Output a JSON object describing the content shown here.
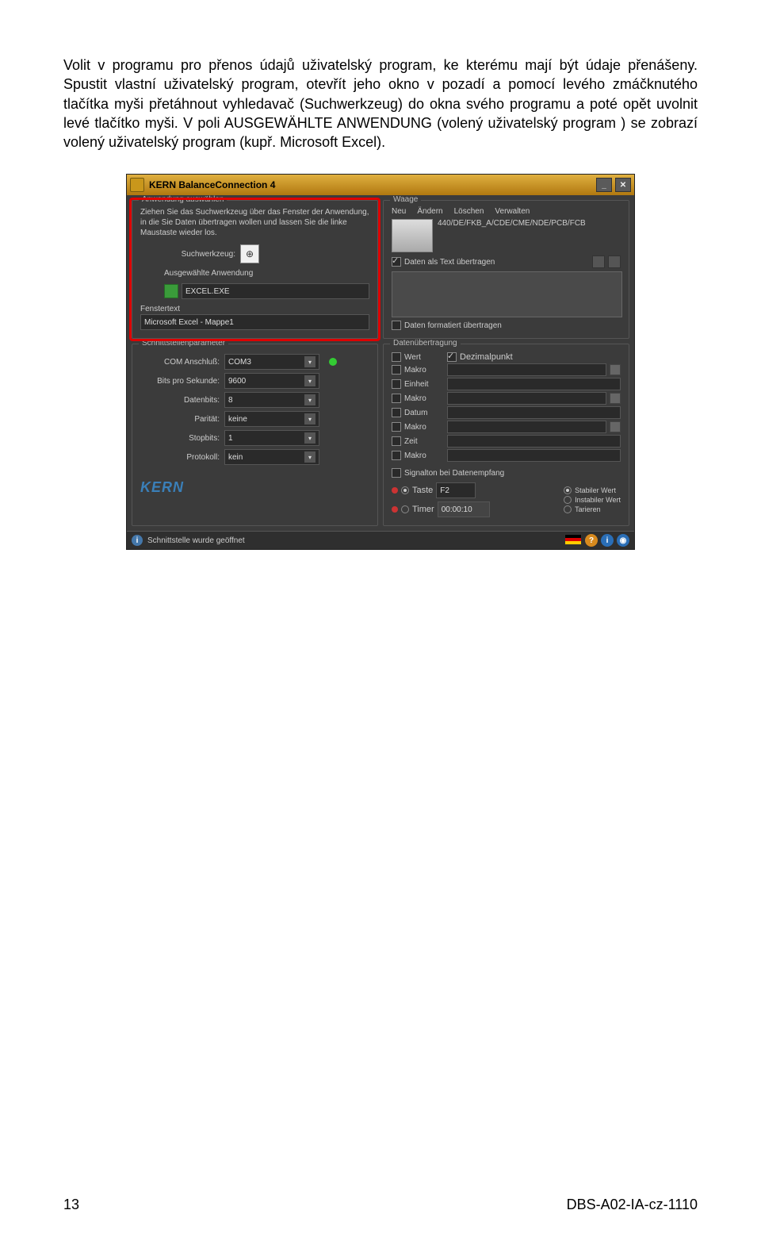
{
  "paragraph": "Volit v programu pro přenos údajů uživatelský program, ke kterému mají být údaje přenášeny. Spustit vlastní uživatelský program, otevřít jeho okno v pozadí a pomocí levého zmáčknutého tlačítka myši přetáhnout vyhledavač (Suchwerkzeug) do okna svého programu a poté opět uvolnit levé tlačítko myši. V poli AUSGEWÄHLTE ANWENDUNG (volený uživatelský program ) se zobrazí volený uživatelský program (kupř. Microsoft Excel).",
  "window": {
    "title": "KERN BalanceConnection 4",
    "groups": {
      "anwendung": {
        "title": "Anwendung auswählen",
        "hint": "Ziehen Sie das Suchwerkzeug über das Fenster der Anwendung, in die Sie Daten übertragen wollen und lassen Sie die linke Maustaste wieder los.",
        "suchwerkzeug_label": "Suchwerkzeug:",
        "ausgewahlte_label": "Ausgewählte Anwendung",
        "ausgewahlte_value": "EXCEL.EXE",
        "fenstertext_label": "Fenstertext",
        "fenstertext_value": "Microsoft Excel - Mappe1"
      },
      "waage": {
        "title": "Waage",
        "buttons": [
          "Neu",
          "Ändern",
          "Löschen",
          "Verwalten"
        ],
        "model": "440/DE/FKB_A/CDE/CME/NDE/PCB/FCB",
        "text_transfer": "Daten als Text übertragen",
        "format_transfer": "Daten formatiert übertragen"
      },
      "schnitt": {
        "title": "Schnittstellenparameter",
        "com_label": "COM Anschluß:",
        "com_value": "COM3",
        "bits_label": "Bits pro Sekunde:",
        "bits_value": "9600",
        "databits_label": "Datenbits:",
        "databits_value": "8",
        "paritat_label": "Parität:",
        "paritat_value": "keine",
        "stopbits_label": "Stopbits:",
        "stopbits_value": "1",
        "protokoll_label": "Protokoll:",
        "protokoll_value": "kein"
      },
      "daten": {
        "title": "Datenübertragung",
        "items": [
          "Wert",
          "Makro",
          "Einheit",
          "Makro",
          "Datum",
          "Makro",
          "Zeit",
          "Makro"
        ],
        "dezimal": "Dezimalpunkt",
        "signalton": "Signalton bei Datenempfang",
        "taste_label": "Taste",
        "taste_value": "F2",
        "timer_label": "Timer",
        "timer_value": "00:00:10",
        "radios": [
          "Stabiler Wert",
          "Instabiler Wert",
          "Tarieren"
        ]
      }
    },
    "logo": "KERN",
    "status": "Schnittstelle wurde geöffnet"
  },
  "footer": {
    "page": "13",
    "doc": "DBS-A02-IA-cz-1110"
  }
}
